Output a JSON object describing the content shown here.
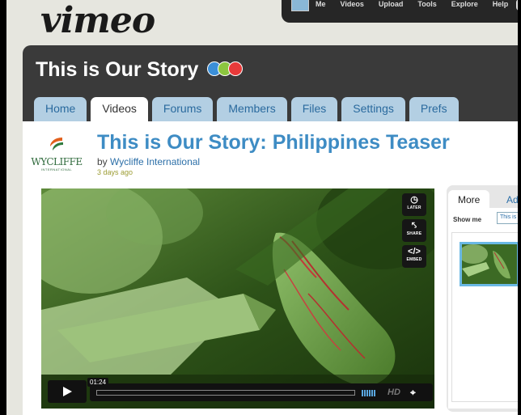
{
  "header": {
    "logo": "vimeo",
    "nav_items": [
      "Me",
      "Videos",
      "Upload",
      "Tools",
      "Explore",
      "Help"
    ]
  },
  "channel": {
    "title": "This is Our Story",
    "tabs": [
      {
        "label": "Home",
        "active": false
      },
      {
        "label": "Videos",
        "active": true
      },
      {
        "label": "Forums",
        "active": false
      },
      {
        "label": "Members",
        "active": false
      },
      {
        "label": "Files",
        "active": false
      },
      {
        "label": "Settings",
        "active": false
      },
      {
        "label": "Prefs",
        "active": false
      }
    ]
  },
  "video": {
    "title": "This is Our Story: Philippines Teaser",
    "by_prefix": "by",
    "author": "Wycliffe International",
    "posted": "3 days ago",
    "brand_name": "WYCLIFFE",
    "brand_sub": "INTERNATIONAL"
  },
  "player": {
    "side_buttons": [
      {
        "icon": "clock-icon",
        "label": "LATER"
      },
      {
        "icon": "share-icon",
        "label": "SHARE"
      },
      {
        "icon": "code-icon",
        "label": "EMBED"
      }
    ],
    "time": "01:24",
    "progress": 0.0,
    "hd_label": "HD"
  },
  "sidebar": {
    "tabs": [
      "More",
      "Add"
    ],
    "show_me_label": "Show me",
    "show_me_value": "This is"
  },
  "colors": {
    "accent_blue": "#3e8cc4",
    "tab_blue": "#b3cfe3",
    "channel_bar": "#3a3a3a",
    "face_blue": "#3b8fd8",
    "face_green": "#8cc63f",
    "face_red": "#e83a3a"
  }
}
